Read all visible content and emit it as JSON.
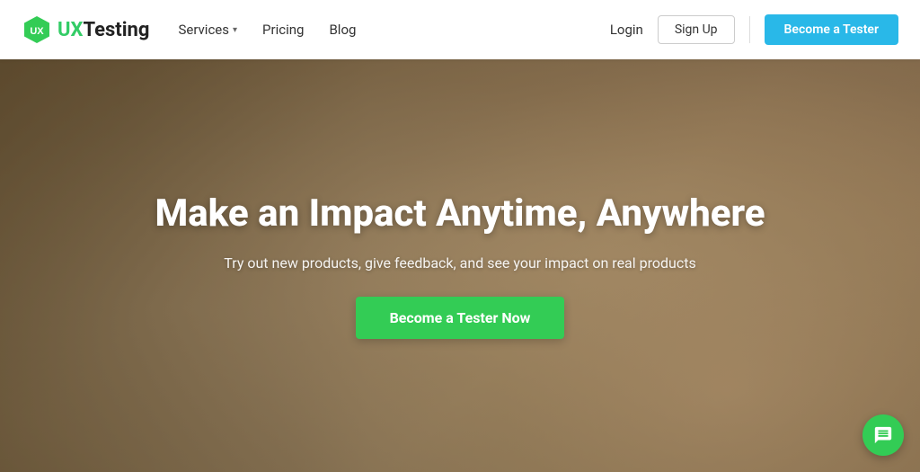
{
  "navbar": {
    "logo_brand": "UX",
    "logo_name": "Testing",
    "nav": {
      "services_label": "Services",
      "pricing_label": "Pricing",
      "blog_label": "Blog"
    },
    "login_label": "Login",
    "signup_label": "Sign Up",
    "become_tester_label": "Become a Tester"
  },
  "hero": {
    "title": "Make an Impact Anytime, Anywhere",
    "subtitle": "Try out new products, give feedback, and see your impact on real products",
    "cta_label": "Become a Tester Now"
  },
  "chat": {
    "label": "Chat"
  }
}
